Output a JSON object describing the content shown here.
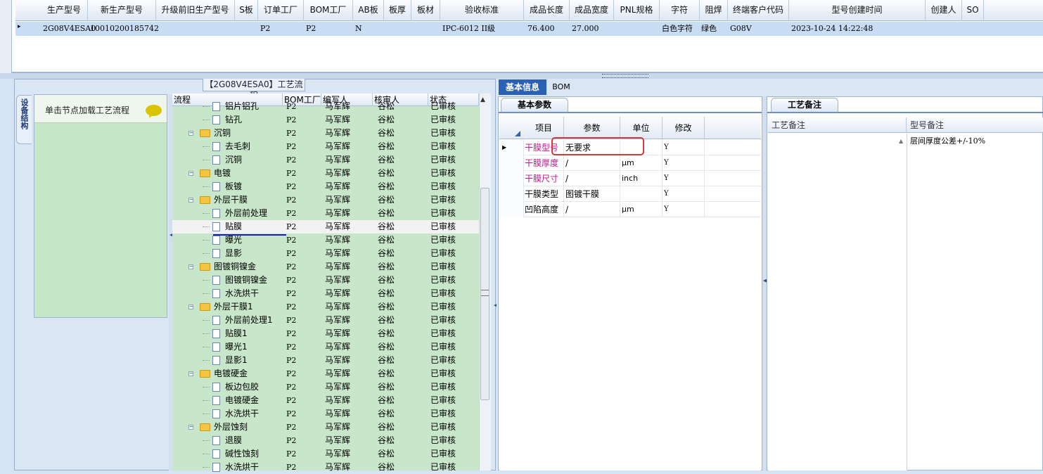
{
  "top_grid": {
    "headers": [
      "生产型号",
      "新生产型号",
      "升级前旧生产型号",
      "S板",
      "订单工厂",
      "BOM工厂",
      "AB板",
      "板厚",
      "板材",
      "验收标准",
      "成品长度",
      "成品宽度",
      "PNL规格",
      "字符",
      "阻焊",
      "终端客户代码",
      "型号创建时间",
      "创建人",
      "SO"
    ],
    "row": [
      "2G08V4ESA0",
      "10010200185742",
      "",
      "",
      "P2",
      "P2",
      "N",
      "",
      "",
      "IPC-6012 II级",
      "76.400",
      "27.000",
      "",
      "白色字符",
      "绿色",
      "G08V",
      "2023-10-24 14:22:48",
      "",
      ""
    ],
    "row_marker": "▸"
  },
  "left_panel": {
    "title": "【2G08V4ESA0】工艺流程",
    "vertical_tab": "设备结构",
    "node_hint": "单击节点加载工艺流程",
    "tree_headers": [
      "流程",
      "BOM工厂",
      "编写人",
      "核审人",
      "状态"
    ],
    "tree_rows": [
      {
        "level": 2,
        "name": "铝片铝孔",
        "bom": "P2",
        "writer": "马军辉",
        "auditor": "谷松",
        "status": "已审核"
      },
      {
        "level": 2,
        "name": "钻孔",
        "bom": "P2",
        "writer": "马军辉",
        "auditor": "谷松",
        "status": "已审核"
      },
      {
        "level": 1,
        "name": "沉铜",
        "bom": "P2",
        "writer": "马军辉",
        "auditor": "谷松",
        "status": "已审核"
      },
      {
        "level": 2,
        "name": "去毛刺",
        "bom": "P2",
        "writer": "马军辉",
        "auditor": "谷松",
        "status": "已审核"
      },
      {
        "level": 2,
        "name": "沉铜",
        "bom": "P2",
        "writer": "马军辉",
        "auditor": "谷松",
        "status": "已审核"
      },
      {
        "level": 1,
        "name": "电镀",
        "bom": "P2",
        "writer": "马军辉",
        "auditor": "谷松",
        "status": "已审核"
      },
      {
        "level": 2,
        "name": "板镀",
        "bom": "P2",
        "writer": "马军辉",
        "auditor": "谷松",
        "status": "已审核"
      },
      {
        "level": 1,
        "name": "外层干膜",
        "bom": "P2",
        "writer": "马军辉",
        "auditor": "谷松",
        "status": "已审核"
      },
      {
        "level": 2,
        "name": "外层前处理",
        "bom": "P2",
        "writer": "马军辉",
        "auditor": "谷松",
        "status": "已审核"
      },
      {
        "level": 2,
        "name": "贴膜",
        "bom": "P2",
        "writer": "马军辉",
        "auditor": "谷松",
        "status": "已审核"
      },
      {
        "level": 2,
        "name": "曝光",
        "bom": "P2",
        "writer": "马军辉",
        "auditor": "谷松",
        "status": "已审核"
      },
      {
        "level": 2,
        "name": "显影",
        "bom": "P2",
        "writer": "马军辉",
        "auditor": "谷松",
        "status": "已审核"
      },
      {
        "level": 1,
        "name": "图镀铜镍金",
        "bom": "P2",
        "writer": "马军辉",
        "auditor": "谷松",
        "status": "已审核"
      },
      {
        "level": 2,
        "name": "图镀铜镍金",
        "bom": "P2",
        "writer": "马军辉",
        "auditor": "谷松",
        "status": "已审核"
      },
      {
        "level": 2,
        "name": "水洗烘干",
        "bom": "P2",
        "writer": "马军辉",
        "auditor": "谷松",
        "status": "已审核"
      },
      {
        "level": 1,
        "name": "外层干膜1",
        "bom": "P2",
        "writer": "马军辉",
        "auditor": "谷松",
        "status": "已审核"
      },
      {
        "level": 2,
        "name": "外层前处理1",
        "bom": "P2",
        "writer": "马军辉",
        "auditor": "谷松",
        "status": "已审核"
      },
      {
        "level": 2,
        "name": "贴膜1",
        "bom": "P2",
        "writer": "马军辉",
        "auditor": "谷松",
        "status": "已审核"
      },
      {
        "level": 2,
        "name": "曝光1",
        "bom": "P2",
        "writer": "马军辉",
        "auditor": "谷松",
        "status": "已审核"
      },
      {
        "level": 2,
        "name": "显影1",
        "bom": "P2",
        "writer": "马军辉",
        "auditor": "谷松",
        "status": "已审核"
      },
      {
        "level": 1,
        "name": "电镀硬金",
        "bom": "P2",
        "writer": "马军辉",
        "auditor": "谷松",
        "status": "已审核"
      },
      {
        "level": 2,
        "name": "板边包胶",
        "bom": "P2",
        "writer": "马军辉",
        "auditor": "谷松",
        "status": "已审核"
      },
      {
        "level": 2,
        "name": "电镀硬金",
        "bom": "P2",
        "writer": "马军辉",
        "auditor": "谷松",
        "status": "已审核"
      },
      {
        "level": 2,
        "name": "水洗烘干",
        "bom": "P2",
        "writer": "马军辉",
        "auditor": "谷松",
        "status": "已审核"
      },
      {
        "level": 1,
        "name": "外层蚀刻",
        "bom": "P2",
        "writer": "马军辉",
        "auditor": "谷松",
        "status": "已审核"
      },
      {
        "level": 2,
        "name": "退膜",
        "bom": "P2",
        "writer": "马军辉",
        "auditor": "谷松",
        "status": "已审核"
      },
      {
        "level": 2,
        "name": "碱性蚀刻",
        "bom": "P2",
        "writer": "马军辉",
        "auditor": "谷松",
        "status": "已审核"
      },
      {
        "level": 2,
        "name": "水洗烘干",
        "bom": "P2",
        "writer": "马军辉",
        "auditor": "谷松",
        "status": "已审核"
      }
    ]
  },
  "right_panel": {
    "tabs": [
      "基本信息",
      "BOM"
    ],
    "sub_tab": "基本参数",
    "param_headers": [
      "项目",
      "参数",
      "单位",
      "修改"
    ],
    "param_rows": [
      {
        "item": "干膜型号",
        "value": "无要求",
        "unit": "",
        "modify": "Y",
        "highlight": true
      },
      {
        "item": "干膜厚度",
        "value": "/",
        "unit": "μm",
        "modify": "Y",
        "highlight": true
      },
      {
        "item": "干膜尺寸",
        "value": "/",
        "unit": "inch",
        "modify": "Y",
        "highlight": true
      },
      {
        "item": "干膜类型",
        "value": "图镀干膜",
        "unit": "",
        "modify": "Y",
        "highlight": false
      },
      {
        "item": "凹陷高度",
        "value": "/",
        "unit": "μm",
        "modify": "Y",
        "highlight": false
      }
    ],
    "notes_tab": "工艺备注",
    "notes_headers": [
      "工艺备注",
      "型号备注"
    ],
    "model_note": "层间厚度公差+/-10%"
  }
}
